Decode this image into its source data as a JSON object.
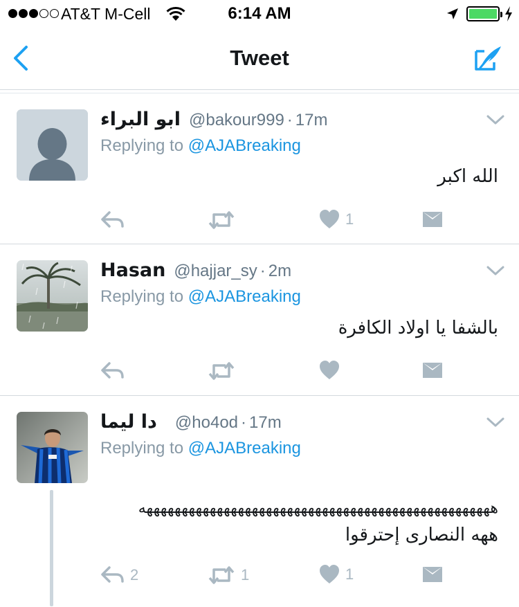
{
  "status_bar": {
    "carrier": "AT&T M-Cell",
    "time": "6:14 AM",
    "signal_bars_filled": 3,
    "signal_bars_total": 5,
    "battery_level": 1.0,
    "battery_color": "#4cd964"
  },
  "nav": {
    "title": "Tweet",
    "back_icon": "chevron-left-icon",
    "compose_icon": "compose-tweet-icon",
    "accent_color": "#1da1f2"
  },
  "tweets": [
    {
      "name": "ابو البراء",
      "handle": "@bakour999",
      "separator": "·",
      "time": "17m",
      "replying_prefix": "Replying to",
      "replying_to": "@AJABreaking",
      "text": "الله اكبر",
      "avatar": "default-avatar",
      "counts": {
        "reply": "",
        "retweet": "",
        "like": "1"
      }
    },
    {
      "name": "Hasan",
      "handle": "@hajjar_sy",
      "separator": "·",
      "time": "2m",
      "replying_prefix": "Replying to",
      "replying_to": "@AJABreaking",
      "text": "بالشفا يا اولاد الكافرة",
      "avatar": "palm-tree-rain-photo",
      "counts": {
        "reply": "",
        "retweet": "",
        "like": ""
      }
    },
    {
      "name": "دا ليما",
      "handle": "@ho4od",
      "separator": "·",
      "time": "17m",
      "replying_prefix": "Replying to",
      "replying_to": "@AJABreaking",
      "text_line1": "ههههههههههههههههههههههههههههههههههههههههههههههههههه",
      "text_line2": "ههه النصارى إحترقوا",
      "avatar": "footballer-celebrating-photo",
      "counts": {
        "reply": "2",
        "retweet": "1",
        "like": "1"
      }
    }
  ]
}
